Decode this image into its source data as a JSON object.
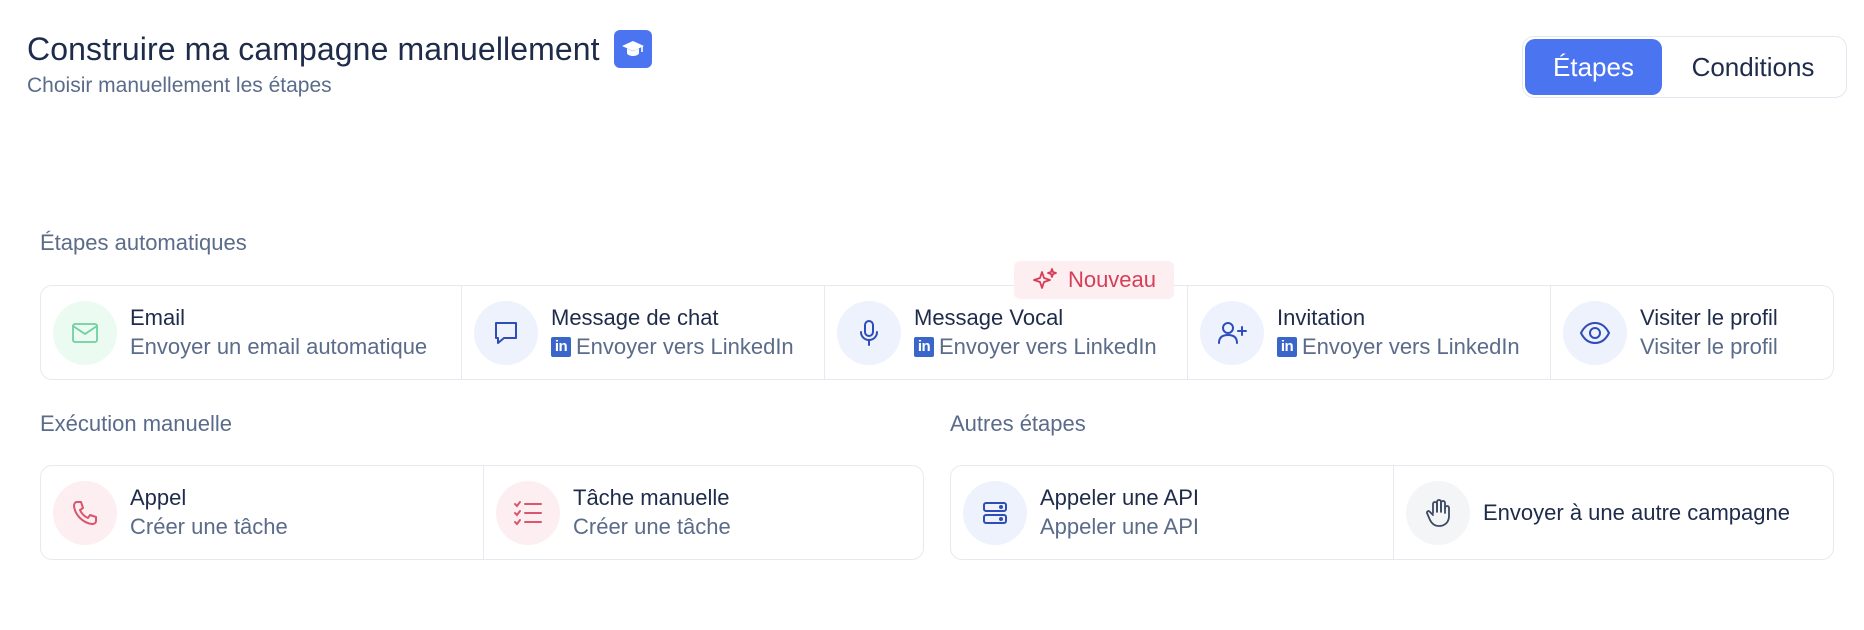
{
  "header": {
    "title": "Construire ma campagne manuellement",
    "subtitle": "Choisir manuellement les étapes",
    "badge_icon": "graduation-cap-icon"
  },
  "toggle": {
    "steps_label": "Étapes",
    "conditions_label": "Conditions",
    "active": "Étapes"
  },
  "colors": {
    "accent": "#4b74f0",
    "new_badge": "#d53e56",
    "linkedin": "#3a66c9"
  },
  "automatic": {
    "label": "Étapes automatiques",
    "new_badge": "Nouveau",
    "cards": [
      {
        "title": "Email",
        "subtitle": "Envoyer un email automatique",
        "icon": "mail-icon"
      },
      {
        "title": "Message de chat",
        "subtitle": "Envoyer vers LinkedIn",
        "icon": "chat-icon",
        "linkedin": true
      },
      {
        "title": "Message Vocal",
        "subtitle": "Envoyer vers LinkedIn",
        "icon": "microphone-icon",
        "linkedin": true
      },
      {
        "title": "Invitation",
        "subtitle": "Envoyer vers LinkedIn",
        "icon": "user-plus-icon",
        "linkedin": true
      },
      {
        "title": "Visiter le profil",
        "subtitle": "Visiter le profil",
        "icon": "eye-icon"
      }
    ]
  },
  "manual": {
    "label": "Exécution manuelle",
    "cards": [
      {
        "title": "Appel",
        "subtitle": "Créer une tâche",
        "icon": "phone-icon"
      },
      {
        "title": "Tâche manuelle",
        "subtitle": "Créer une tâche",
        "icon": "task-list-icon"
      }
    ]
  },
  "other": {
    "label": "Autres étapes",
    "cards": [
      {
        "title": "Appeler une API",
        "subtitle": "Appeler une API",
        "icon": "server-icon"
      },
      {
        "title": "Envoyer à une autre campagne",
        "icon": "hand-icon"
      }
    ]
  }
}
